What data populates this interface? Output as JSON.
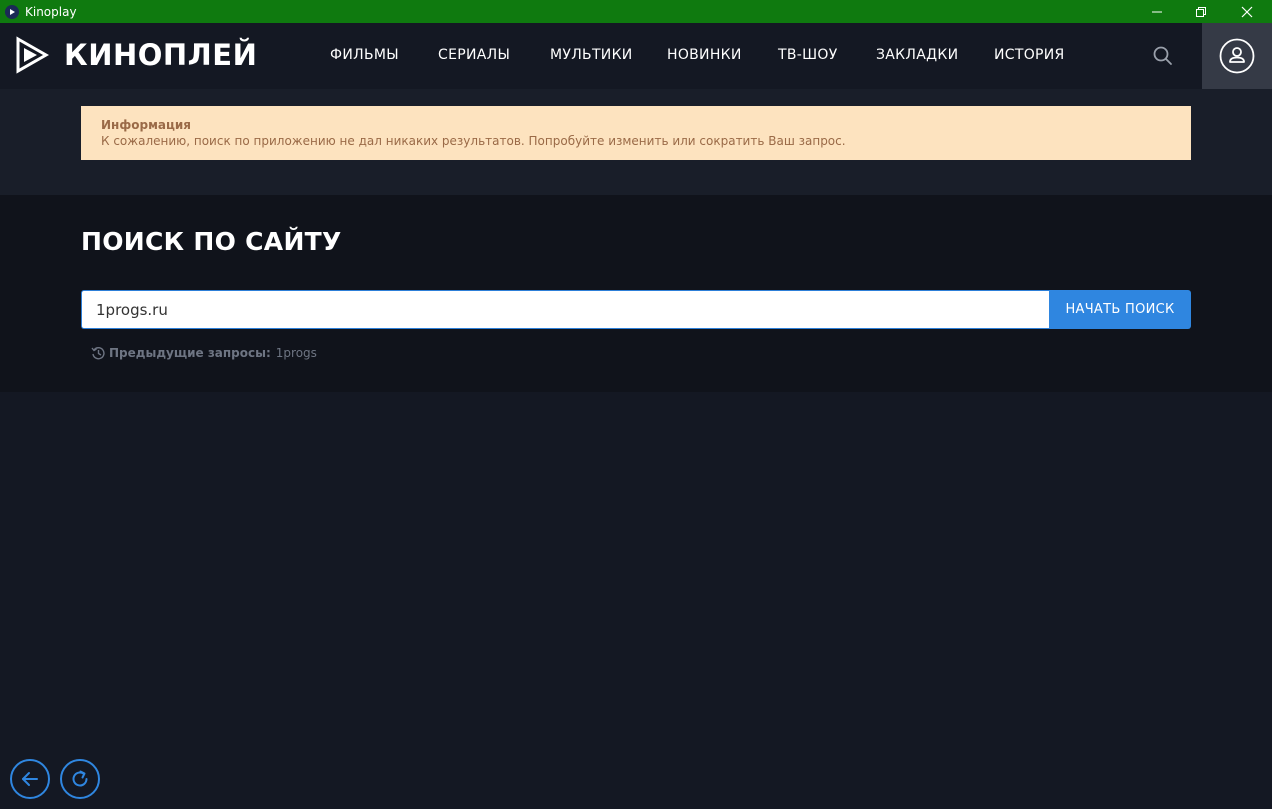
{
  "window": {
    "title": "Kinoplay",
    "controls": [
      "minimize",
      "maximize",
      "close"
    ]
  },
  "header": {
    "logo_text": "КИНОПЛЕЙ",
    "nav": [
      {
        "label": "ФИЛЬМЫ",
        "id": "films"
      },
      {
        "label": "СЕРИАЛЫ",
        "id": "serials"
      },
      {
        "label": "МУЛЬТИКИ",
        "id": "cartoons"
      },
      {
        "label": "НОВИНКИ",
        "id": "new"
      },
      {
        "label": "ТВ-ШОУ",
        "id": "tv-show"
      },
      {
        "label": "ЗАКЛАДКИ",
        "id": "bookmarks"
      },
      {
        "label": "ИСТОРИЯ",
        "id": "history"
      }
    ],
    "icons": {
      "search": "search-icon",
      "profile": "user-icon"
    }
  },
  "info": {
    "title": "Информация",
    "text": "К сожалению, поиск по приложению не дал никаких результатов. Попробуйте изменить или сократить Ваш запрос."
  },
  "search": {
    "heading": "ПОИСК ПО САЙТУ",
    "value": "1progs.ru",
    "button_label": "НАЧАТЬ ПОИСК",
    "previous_label": "Предыдущие запросы:",
    "previous_queries": [
      "1progs"
    ]
  },
  "footer": {
    "icons": {
      "back": "arrow-left-icon",
      "reload": "reload-icon"
    }
  },
  "colors": {
    "titlebar": "#0f7a0f",
    "background": "#141823",
    "accent": "#2f86e0",
    "info_bg": "#fde3bf",
    "info_text": "#9a6a47"
  }
}
